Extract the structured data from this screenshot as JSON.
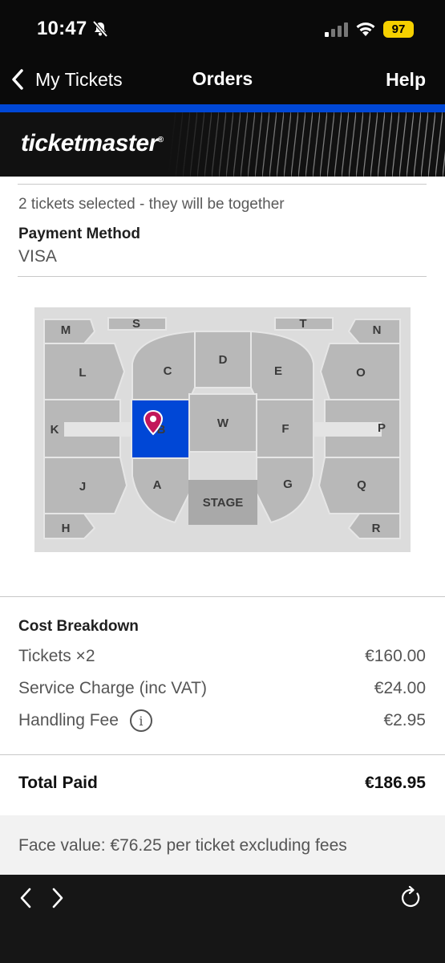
{
  "status_bar": {
    "time": "10:47",
    "battery": "97"
  },
  "nav": {
    "back_label": "My Tickets",
    "title": "Orders",
    "help_label": "Help"
  },
  "brand": {
    "logo_text": "ticketmaster",
    "logo_mark": "®"
  },
  "order": {
    "tickets_note": "2 tickets selected - they will be together",
    "payment_method_label": "Payment Method",
    "payment_method_value": "VISA"
  },
  "seat_map": {
    "sections": [
      "M",
      "S",
      "T",
      "N",
      "L",
      "C",
      "D",
      "E",
      "O",
      "K",
      "B",
      "W",
      "F",
      "P",
      "J",
      "A",
      "STAGE",
      "G",
      "Q",
      "H",
      "R"
    ],
    "selected_section": "B",
    "colors": {
      "background": "#dcdcdc",
      "section": "#b8b8b8",
      "stage": "#a9a9a9",
      "selected": "#0047d6",
      "marker": "#c2185b"
    }
  },
  "cost": {
    "title": "Cost Breakdown",
    "rows": [
      {
        "label": "Tickets ×2",
        "value": "€160.00"
      },
      {
        "label": "Service Charge (inc VAT)",
        "value": "€24.00"
      },
      {
        "label": "Handling Fee",
        "value": "€2.95",
        "icon": "info-icon"
      }
    ],
    "total_label": "Total Paid",
    "total_value": "€186.95"
  },
  "face_value_note": "Face value: €76.25 per ticket excluding fees",
  "toolbar": {
    "icons": [
      "back-arrow-icon",
      "forward-arrow-icon",
      "refresh-icon"
    ]
  },
  "colors": {
    "accent": "#0047d6",
    "header_bg": "#0a0a0a",
    "battery": "#f5d000"
  }
}
